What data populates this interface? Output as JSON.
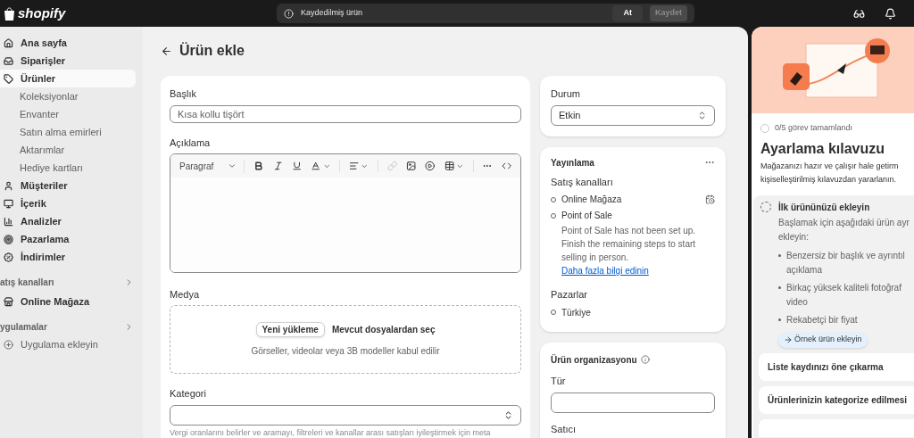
{
  "top_bar": {
    "logo": "shopify",
    "unsaved_message": "Kaydedilmiş ürün",
    "buttons": [
      {
        "label": "At",
        "disabled": false
      },
      {
        "label": "Kaydet",
        "disabled": true
      }
    ]
  },
  "sidebar": {
    "items": [
      {
        "kind": "main",
        "label": "Ana sayfa",
        "selected": false
      },
      {
        "kind": "main",
        "label": "Siparişler",
        "selected": false
      },
      {
        "kind": "main",
        "label": "Ürünler",
        "selected": true
      },
      {
        "kind": "sub",
        "label": "Koleksiyonlar",
        "selected": false
      },
      {
        "kind": "sub",
        "label": "Envanter",
        "selected": false
      },
      {
        "kind": "sub",
        "label": "Satın alma emirleri",
        "selected": false
      },
      {
        "kind": "sub",
        "label": "Aktarımlar",
        "selected": false
      },
      {
        "kind": "sub",
        "label": "Hediye kartları",
        "selected": false
      },
      {
        "kind": "main",
        "label": "Müşteriler",
        "selected": false
      },
      {
        "kind": "main",
        "label": "İçerik",
        "selected": false
      },
      {
        "kind": "main",
        "label": "Analizler",
        "selected": false
      },
      {
        "kind": "main",
        "label": "Pazarlama",
        "selected": false
      },
      {
        "kind": "main",
        "label": "İndirimler",
        "selected": false
      },
      {
        "kind": "section",
        "label": "atış kanalları",
        "selected": false
      },
      {
        "kind": "main",
        "label": "Online Mağaza",
        "selected": false
      },
      {
        "kind": "section",
        "label": "ygulamalar",
        "selected": false
      },
      {
        "kind": "add",
        "label": "Uygulama ekleyin",
        "selected": false
      }
    ]
  },
  "page": {
    "title": "Ürün ekle"
  },
  "product_card": {
    "title_label": "Başlık",
    "title_placeholder": "Kısa kollu tişört",
    "description_label": "Açıklama",
    "paragraph_select": "Paragraf",
    "media_label": "Medya",
    "upload_button": "Yeni yükleme",
    "choose_existing": "Mevcut dosyalardan seç",
    "media_hint": "Görseller, videolar veya 3B modeller kabul edilir",
    "category_label": "Kategori",
    "category_hint": "Vergi oranlarını belirler ve aramayı, filtreleri ve kanallar arası satışları iyileştirmek için meta"
  },
  "status_card": {
    "label": "Durum",
    "value": "Etkin"
  },
  "publishing_card": {
    "title": "Yayınlama",
    "channels_label": "Satış kanalları",
    "channels": [
      {
        "name": "Online Mağaza"
      },
      {
        "name": "Point of Sale",
        "note": "Point of Sale has not been set up. Finish the remaining steps to start selling in person.",
        "link": "Daha fazla bilgi edinin"
      }
    ],
    "markets_label": "Pazarlar",
    "markets": [
      {
        "name": "Türkiye"
      }
    ]
  },
  "organization_card": {
    "title": "Ürün organizasyonu",
    "fields": [
      {
        "label": "Tür"
      },
      {
        "label": "Satıcı"
      }
    ]
  },
  "setup_guide": {
    "progress": "0/5 görev tamamlandı",
    "title": "Ayarlama kılavuzu",
    "description_lines": [
      "Mağazanızı hazır ve çalışır hale getirm",
      "kişiselleştirilmiş kılavuzdan yararlanın."
    ],
    "steps": [
      {
        "title": "İlk ürününüzü ekleyin",
        "expanded": true,
        "intro_lines": [
          "Başlamak için aşağıdaki ürün ayr",
          "ekleyin:"
        ],
        "bullets": [
          [
            "Benzersiz bir başlık ve ayrıntıl",
            "açıklama"
          ],
          [
            "Birkaç yüksek kaliteli fotoğraf",
            "video"
          ],
          [
            "Rekabetçi bir fiyat"
          ]
        ],
        "action": "Örnek ürün ekleyin"
      },
      {
        "title": "Liste kaydınızı öne çıkarma",
        "expanded": false
      },
      {
        "title": "Ürünlerinizin kategorize edilmesi",
        "expanded": false
      }
    ]
  }
}
